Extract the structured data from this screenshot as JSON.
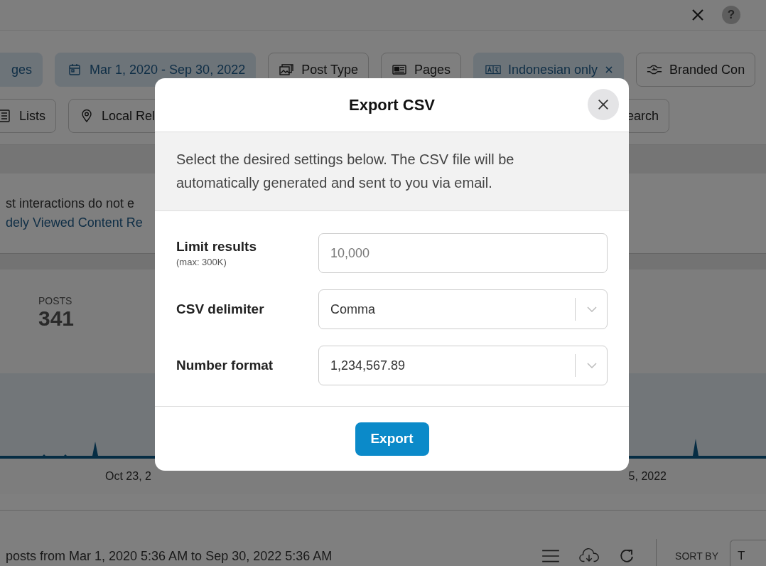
{
  "top_bar": {
    "help_label": "?"
  },
  "filters": [
    [
      {
        "label": "ges",
        "selected": true,
        "removable": false
      },
      {
        "label": "Mar 1, 2020 - Sep 30, 2022",
        "selected": true,
        "removable": false
      },
      {
        "label": "Post Type",
        "selected": false,
        "removable": false
      },
      {
        "label": "Pages",
        "selected": false,
        "removable": false
      },
      {
        "label": "Indonesian only",
        "selected": true,
        "removable": true
      },
      {
        "label": "Branded Con",
        "selected": false,
        "removable": false
      }
    ],
    [
      {
        "label": "Lists",
        "selected": false,
        "removable": false
      },
      {
        "label": "Local Rel",
        "selected": false,
        "removable": false
      },
      {
        "label": "earch",
        "selected": false,
        "removable": false
      }
    ]
  ],
  "notice": {
    "text": "st interactions do not e",
    "link": "dely Viewed Content Re"
  },
  "stats": {
    "label": "POSTS",
    "value": "341"
  },
  "chart_axis": [
    "Oct 23, 2",
    "5, 2022"
  ],
  "footer": {
    "summary": "posts from Mar 1, 2020 5:36 AM to Sep 30, 2022 5:36 AM",
    "sort_label": "SORT BY",
    "sort_value": "T"
  },
  "modal": {
    "title": "Export CSV",
    "description": "Select the desired settings below. The CSV file will be automatically generated and sent to you via email.",
    "fields": [
      {
        "kind": "input",
        "label": "Limit results",
        "hint": "(max: 300K)",
        "placeholder": "10,000"
      },
      {
        "kind": "select",
        "label": "CSV delimiter",
        "value": "Comma"
      },
      {
        "kind": "select",
        "label": "Number format",
        "value": "1,234,567.89"
      }
    ],
    "button": "Export"
  }
}
